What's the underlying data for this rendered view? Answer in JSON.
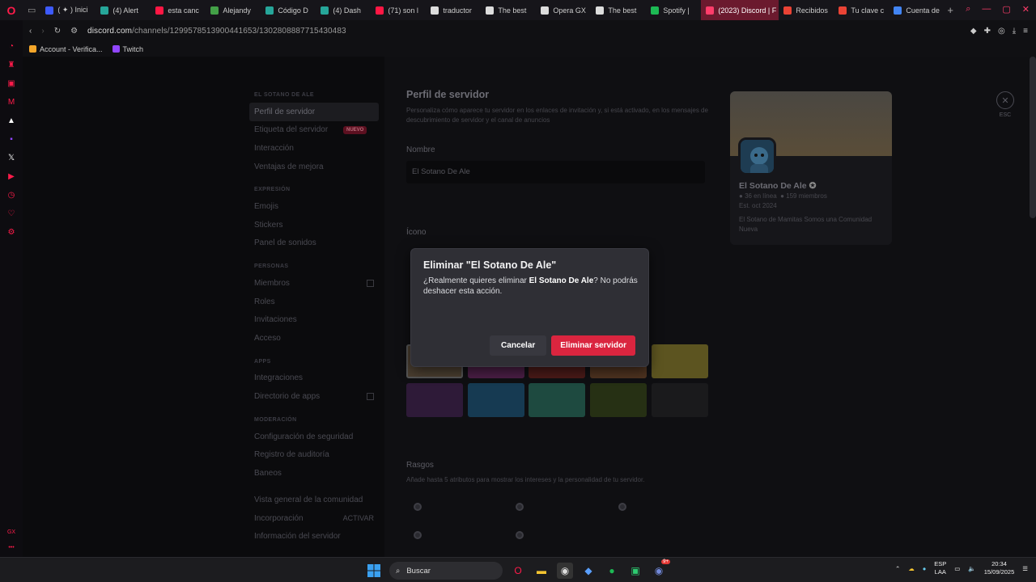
{
  "browser": {
    "tabs": [
      {
        "label": "( ✦ ) Inici",
        "color": "#3d5afe"
      },
      {
        "label": "(4) Alert",
        "color": "#26a69a"
      },
      {
        "label": "esta canc",
        "color": "#ff1744"
      },
      {
        "label": "Alejandy",
        "color": "#43a047"
      },
      {
        "label": "Código D",
        "color": "#26a69a"
      },
      {
        "label": "(4) Dash",
        "color": "#26a69a"
      },
      {
        "label": "(71) son l",
        "color": "#ff1744"
      },
      {
        "label": "traductor",
        "color": "#dddddd"
      },
      {
        "label": "The best",
        "color": "#dddddd"
      },
      {
        "label": "Opera GX",
        "color": "#dddddd"
      },
      {
        "label": "The best",
        "color": "#dddddd"
      },
      {
        "label": "Spotify | ",
        "color": "#1db954"
      },
      {
        "label": "(2023) Discord | F",
        "color": "#ff3d6b",
        "active": true
      },
      {
        "label": "Recibidos",
        "color": "#ea4335"
      },
      {
        "label": "Tu clave c",
        "color": "#ea4335"
      },
      {
        "label": "Cuenta de",
        "color": "#4285f4"
      }
    ],
    "new_tab": "+",
    "url_host": "discord.com",
    "url_path": "/channels/1299578513900441653/1302808887715430483",
    "bookmarks": [
      "Account - Verifica...",
      "Twitch"
    ]
  },
  "settings_nav": {
    "server_name_header": "EL SOTANO DE ALE",
    "items_top": [
      "Perfil de servidor",
      "Etiqueta del servidor",
      "Interacción",
      "Ventajas de mejora"
    ],
    "badge_new": "NUEVO",
    "sec_expression": "EXPRESIÓN",
    "items_expression": [
      "Emojis",
      "Stickers",
      "Panel de sonidos"
    ],
    "sec_people": "PERSONAS",
    "items_people": [
      "Miembros",
      "Roles",
      "Invitaciones",
      "Acceso"
    ],
    "sec_apps": "APPS",
    "items_apps": [
      "Integraciones",
      "Directorio de apps"
    ],
    "sec_moderation": "MODERACIÓN",
    "items_moderation": [
      "Configuración de seguridad",
      "Registro de auditoría",
      "Baneos"
    ],
    "items_community": [
      "Vista general de la comunidad",
      "Incorporación",
      "Información del servidor"
    ],
    "activate_label": "ACTIVAR"
  },
  "profile": {
    "title": "Perfil de servidor",
    "description": "Personaliza cómo aparece tu servidor en los enlaces de invitación y, si está activado, en los mensajes de descubrimiento de servidor y el canal de anuncios",
    "name_label": "Nombre",
    "name_value": "El Sotano De Ale",
    "icon_label": "Ícono",
    "traits_label": "Rasgos",
    "traits_desc": "Añade hasta 5 atributos para mostrar los intereses y la personalidad de tu servidor."
  },
  "preview_card": {
    "name": "El Sotano De Ale",
    "online": "36 en línea",
    "members": "159 miembros",
    "established": "Est. oct 2024",
    "bio": "El Sotano de Mamitas Somos una Comunidad Nueva"
  },
  "close_label": "ESC",
  "modal": {
    "title": "Eliminar \"El Sotano De Ale\"",
    "body_prefix": "¿Realmente quieres eliminar ",
    "body_bold": "El Sotano De Ale",
    "body_suffix": "? No podrás deshacer esta acción.",
    "cancel": "Cancelar",
    "confirm": "Eliminar servidor"
  },
  "taskbar": {
    "search": "Buscar",
    "lang_top": "ESP",
    "lang_bottom": "LAA",
    "time": "20:34",
    "date": "15/09/2025",
    "discord_badge": "9+"
  }
}
